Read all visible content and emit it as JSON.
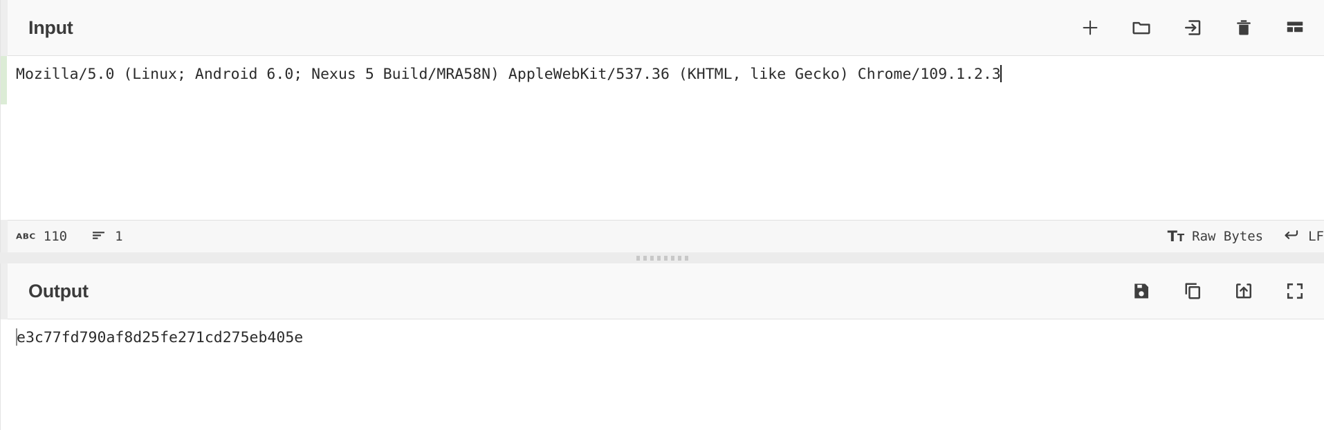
{
  "input_panel": {
    "title": "Input",
    "toolbar": [
      {
        "name": "add-input-button",
        "icon": "plus-icon",
        "label": "Add a new input"
      },
      {
        "name": "open-folder-button",
        "icon": "folder-icon",
        "label": "Open folder as input"
      },
      {
        "name": "open-file-button",
        "icon": "file-import-icon",
        "label": "Open file as input"
      },
      {
        "name": "clear-input-button",
        "icon": "trash-icon",
        "label": "Clear input and output"
      },
      {
        "name": "reset-layout-button",
        "icon": "layout-panels-icon",
        "label": "Reset pane layout"
      }
    ],
    "content": "Mozilla/5.0 (Linux; Android 6.0; Nexus 5 Build/MRA58N) AppleWebKit/537.36 (KHTML, like Gecko) Chrome/109.1.2.3",
    "status_bar": {
      "length_icon": "ABC",
      "length_label": "Length",
      "length_value": "110",
      "lines_icon": "lines-icon",
      "lines_label": "Lines",
      "lines_value": "1",
      "encoding_icon": "Tt",
      "encoding_value": "Raw Bytes",
      "line_ending_icon": "return-arrow-icon",
      "line_ending_value": "LF"
    }
  },
  "output_panel": {
    "title": "Output",
    "toolbar": [
      {
        "name": "save-output-button",
        "icon": "floppy-save-icon",
        "label": "Save output to file"
      },
      {
        "name": "copy-output-button",
        "icon": "copy-icon",
        "label": "Copy raw output to the clipboard"
      },
      {
        "name": "replace-input-button",
        "icon": "upload-box-icon",
        "label": "Replace input with output"
      },
      {
        "name": "maximise-output-button",
        "icon": "fullscreen-icon",
        "label": "Maximise output pane"
      }
    ],
    "content": "e3c77fd790af8d25fe271cd275eb405e"
  },
  "splitter": {
    "name": "pane-splitter",
    "dots": 8
  },
  "colors": {
    "accent_active_line": "#dcecd6",
    "header_bg": "#f9f9f9",
    "status_bg": "#f7f7f7",
    "border": "#e0e0e0",
    "text": "#2b2b2b",
    "icon": "#3f3f3f"
  }
}
